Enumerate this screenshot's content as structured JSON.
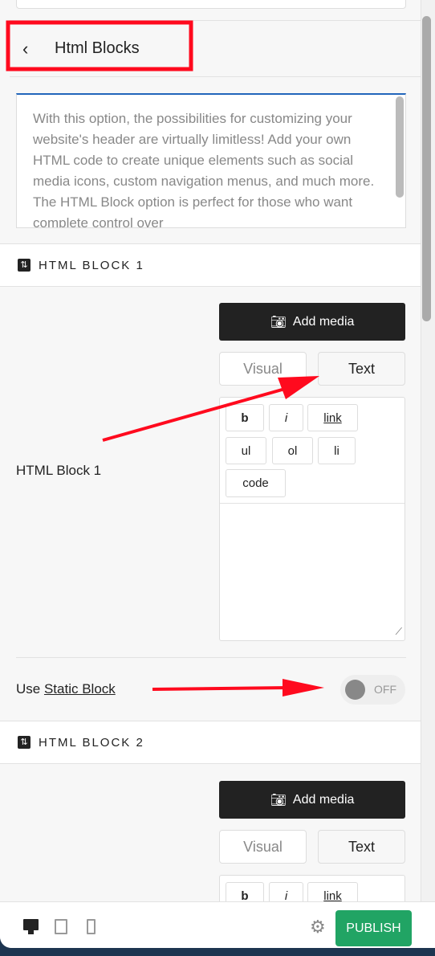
{
  "header": {
    "title": "Html Blocks",
    "back_icon": "chevron-left-icon"
  },
  "description": "With this option, the possibilities for customizing your website's header are virtually limitless! Add your own HTML code to create unique elements such as social media icons, custom navigation menus, and much more. The HTML Block option is perfect for those who want complete control over",
  "blocks": [
    {
      "section_title": "HTML BLOCK 1",
      "label": "HTML Block 1",
      "add_media": "Add media",
      "tab_visual": "Visual",
      "tab_text": "Text",
      "quicktags": [
        "b",
        "i",
        "link",
        "ul",
        "ol",
        "li",
        "code"
      ],
      "content": ""
    },
    {
      "section_title": "HTML BLOCK 2",
      "add_media": "Add media",
      "tab_visual": "Visual",
      "tab_text": "Text",
      "quicktags": [
        "b",
        "i",
        "link"
      ]
    }
  ],
  "static_block": {
    "prefix": "Use",
    "link": "Static Block",
    "toggle_state": "OFF"
  },
  "footer": {
    "publish": "PUBLISH",
    "devices": [
      "desktop",
      "tablet",
      "mobile"
    ]
  },
  "colors": {
    "publish": "#21a464",
    "annotation": "#ff0a1e",
    "active_tab_border": "#2266bb"
  }
}
